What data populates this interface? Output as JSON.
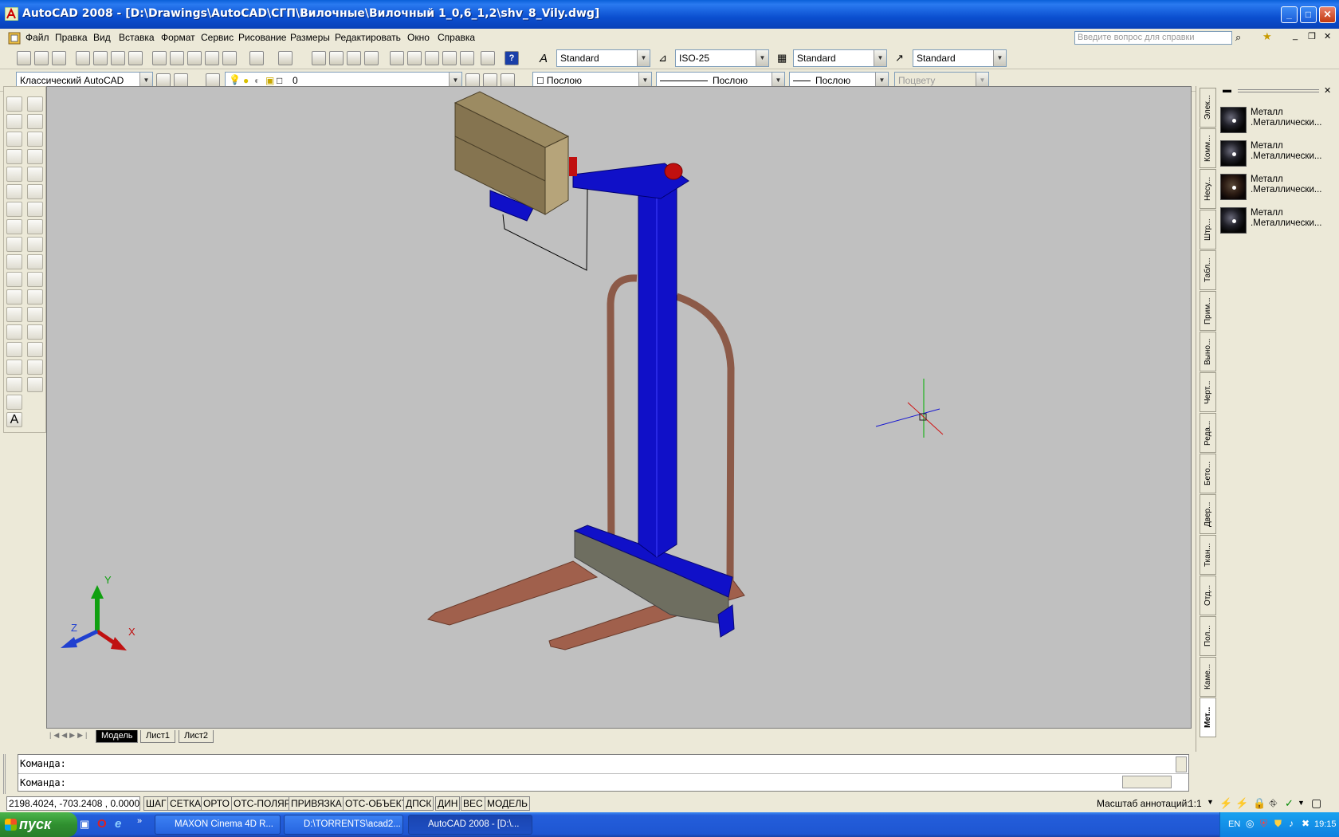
{
  "window": {
    "title": "AutoCAD 2008 - [D:\\Drawings\\AutoCAD\\СГП\\Вилочные\\Вилочный 1_0,6_1,2\\shv_8_Vily.dwg]",
    "min_label": "_",
    "max_label": "□",
    "close_label": "✕"
  },
  "menu": {
    "items": [
      "Файл",
      "Правка",
      "Вид",
      "Вставка",
      "Формат",
      "Сервис",
      "Рисование",
      "Размеры",
      "Редактировать",
      "Окно",
      "Справка"
    ],
    "help_placeholder": "Введите вопрос для справки"
  },
  "toolbar1": {
    "text_style": "Standard",
    "dim_style": "ISO-25",
    "table_style": "Standard",
    "mleader_style": "Standard"
  },
  "toolbar2": {
    "workspace": "Классический AutoCAD",
    "layer": "0",
    "color": "Послою",
    "linetype": "Послою",
    "lineweight": "Послою",
    "plotstyle": "Поцвету"
  },
  "layout_tabs": [
    "Модель",
    "Лист1",
    "Лист2"
  ],
  "command": {
    "line1": "Команда:",
    "line2": "Команда:"
  },
  "status": {
    "coords": "2198.4024, -703.2408 , 0.0000",
    "buttons": [
      "ШАГ",
      "СЕТКА",
      "ОРТО",
      "ОТС-ПОЛЯР",
      "ПРИВЯЗКА",
      "ОТС-ОБЪЕКТ",
      "ДПСК",
      "ДИН",
      "ВЕС",
      "МОДЕЛЬ"
    ],
    "annotation_scale_label": "Масштаб аннотаций:",
    "annotation_scale_value": "1:1"
  },
  "palette": {
    "tabs": [
      "Элек...",
      "Комм...",
      "Несу...",
      "Штр...",
      "Табл...",
      "Прим...",
      "Выно...",
      "Черт...",
      "Реда...",
      "Бето...",
      "Двер...",
      "Ткан...",
      "Отд...",
      "Пол...",
      "Каме...",
      "Мет..."
    ],
    "materials": [
      {
        "name": "Металл",
        "sub": ".Металлически..."
      },
      {
        "name": "Металл",
        "sub": ".Металлически..."
      },
      {
        "name": "Металл",
        "sub": ".Металлически..."
      },
      {
        "name": "Металл",
        "sub": ".Металлически..."
      }
    ]
  },
  "ucs": {
    "x": "X",
    "y": "Y",
    "z": "Z"
  },
  "taskbar": {
    "start_label": "пуск",
    "tasks": [
      "MAXON Cinema 4D R...",
      "D:\\TORRENTS\\acad2...",
      "AutoCAD 2008 - [D:\\..."
    ],
    "lang": "EN",
    "clock": "19:15"
  },
  "colors": {
    "viewport_bg": "#c0c0c0",
    "mast_blue": "#1010c8",
    "fork_brown": "#a0604c",
    "box_tan": "#8b7a55",
    "xp_blue": "#245edb"
  }
}
